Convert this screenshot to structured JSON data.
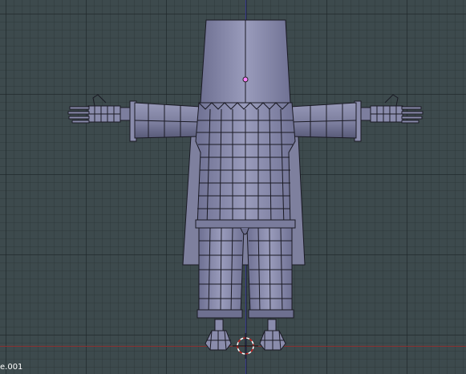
{
  "viewport": {
    "background_color": "#3d4a4d",
    "mesh_fill_color": "#8e90b0",
    "mesh_shadow_color": "#6d6f8f",
    "mesh_wire_color": "#1a1a24",
    "x_axis_color": "#8a3030",
    "z_axis_color": "#36368a",
    "object_origin_color": "#ff80ff",
    "cursor_color": "#cc2222"
  },
  "object_label": "e.001"
}
